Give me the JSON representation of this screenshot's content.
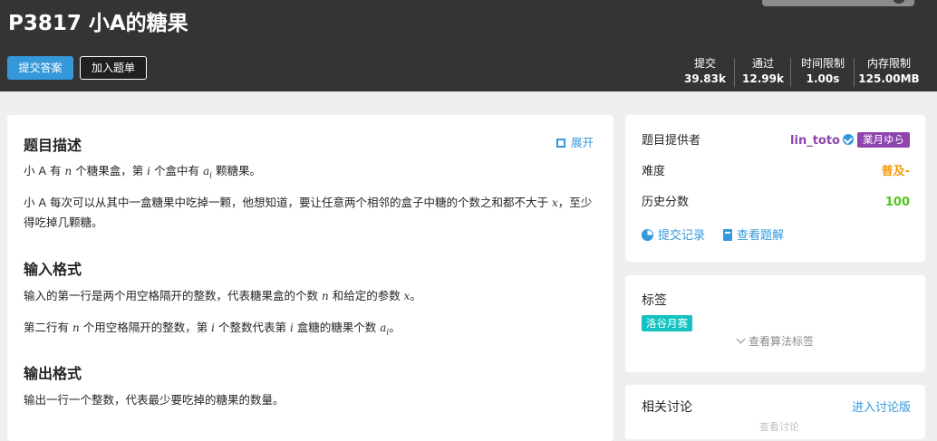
{
  "header": {
    "title": "P3817 小A的糖果",
    "submit_button": "提交答案",
    "add_to_list_button": "加入题单",
    "stats": [
      {
        "label": "提交",
        "value": "39.83k"
      },
      {
        "label": "通过",
        "value": "12.99k"
      },
      {
        "label": "时间限制",
        "value": "1.00s"
      },
      {
        "label": "内存限制",
        "value": "125.00MB"
      }
    ]
  },
  "problem": {
    "description_heading": "题目描述",
    "expand_label": "展开",
    "desc_p1": {
      "t1": "小 A 有 ",
      "m1": "n",
      "t2": " 个糖果盒，第 ",
      "m2": "i",
      "t3": " 个盒中有 ",
      "m3": "a",
      "m3sub": "i",
      "t4": " 颗糖果。"
    },
    "desc_p2": {
      "t1": "小 A 每次可以从其中一盒糖果中吃掉一颗，他想知道，要让任意两个相邻的盒子中糖的个数之和都不大于",
      "m1": "x",
      "t2": "，至少得吃掉几颗糖。"
    },
    "input_heading": "输入格式",
    "input_p1": {
      "t1": "输入的第一行是两个用空格隔开的整数，代表糖果盒的个数 ",
      "m1": "n",
      "t2": " 和给定的参数 ",
      "m2": "x",
      "t3": "。"
    },
    "input_p2": {
      "t1": "第二行有 ",
      "m1": "n",
      "t2": " 个用空格隔开的整数，第 ",
      "m2": "i",
      "t3": " 个整数代表第 ",
      "m3": "i",
      "t4": " 盒糖的糖果个数 ",
      "m4": "a",
      "m4sub": "i",
      "t5": "。"
    },
    "output_heading": "输出格式",
    "output_p1": "输出一行一个整数，代表最少要吃掉的糖果的数量。"
  },
  "sidebar": {
    "provider_label": "题目提供者",
    "provider_name": "lin_toto",
    "provider_badge": "業月ゆら",
    "difficulty_label": "难度",
    "difficulty_value": "普及-",
    "score_label": "历史分数",
    "score_value": "100",
    "submissions_link": "提交记录",
    "solutions_link": "查看题解",
    "tags_title": "标签",
    "tag": "洛谷月赛",
    "show_tags": "查看算法标签",
    "discussion_title": "相关讨论",
    "discussion_link": "进入讨论版",
    "discussion_faded": "查看讨论"
  },
  "colors": {
    "header_bg": "#333436",
    "accent": "#3498db",
    "user_purple": "#8e44ad",
    "difficulty_orange": "#f39c11",
    "score_green": "#52c41a",
    "tag_teal": "#13c2c2"
  }
}
